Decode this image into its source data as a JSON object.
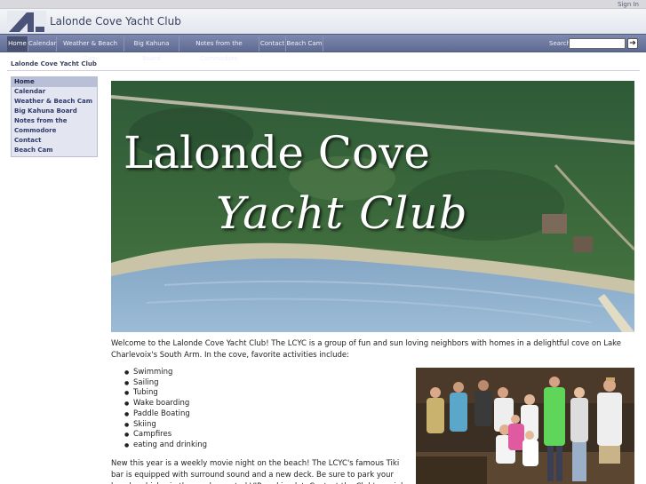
{
  "topbar": {
    "sign_in": "Sign In"
  },
  "header": {
    "site_title": "Lalonde Cove Yacht Club"
  },
  "nav": {
    "tabs": [
      {
        "label": "Home",
        "active": true
      },
      {
        "label": "Calendar"
      },
      {
        "label": "Weather & Beach Cam"
      },
      {
        "label": "Big Kahuna Board"
      },
      {
        "label": "Notes from the Commodore"
      },
      {
        "label": "Contact"
      },
      {
        "label": "Beach Cam"
      }
    ],
    "search_label": "Search",
    "search_value": "",
    "search_button_icon": "arrow-right-icon"
  },
  "breadcrumb": {
    "text": "Lalonde Cove Yacht Club"
  },
  "sidebar": {
    "items": [
      {
        "label": "Home",
        "active": true
      },
      {
        "label": "Calendar"
      },
      {
        "label": "Weather & Beach Cam"
      },
      {
        "label": "Big Kahuna Board"
      },
      {
        "label": "Notes from the"
      },
      {
        "label": "Commodore"
      },
      {
        "label": "Contact"
      },
      {
        "label": "Beach Cam"
      }
    ]
  },
  "hero": {
    "title": "Lalonde Cove",
    "subtitle": "Yacht Club"
  },
  "content": {
    "intro": "Welcome to the Lalonde Cove Yacht Club! The LCYC is a group of fun and sun loving neighbors with homes in a delightful cove on Lake Charlevoix's South Arm. In the cove, favorite activities include:",
    "activities": [
      "Swimming",
      "Sailing",
      "Tubing",
      "Wake boarding",
      "Paddle Boating",
      "Skiing",
      "Campfires",
      "eating and drinking"
    ],
    "news": "New this year is a weekly movie night on the beach! The LCYC's famous Tiki bar is equipped with surround sound and a new deck. Be sure to park your beach vehicles in the newly created VIP parking lot. Contact the Club's social coordinator for our volleyball"
  },
  "colors": {
    "nav": "#6b759c",
    "header": "#eceef4",
    "accent": "#3a4260",
    "sidebar": "#e3e6f1"
  }
}
